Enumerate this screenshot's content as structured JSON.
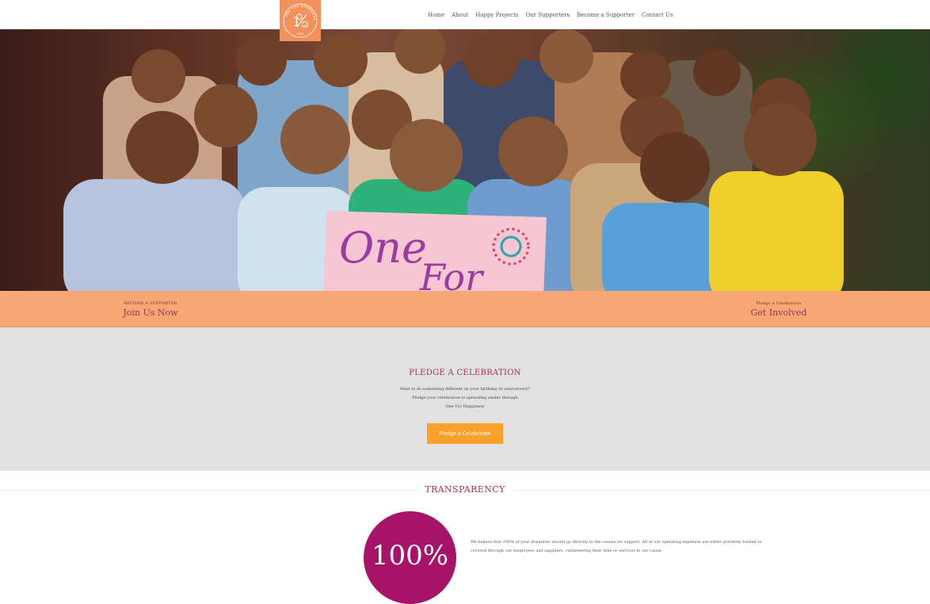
{
  "header": {
    "logo_ring_text": "ONE FOR HAPPINESS",
    "logo_bottom_text": "OFH",
    "nav": [
      "Home",
      "About",
      "Happy Projects",
      "Our Supporters",
      "Become a Supporter",
      "Contact Us"
    ]
  },
  "hero": {
    "banner_text": [
      "One",
      "For"
    ]
  },
  "band": {
    "left": {
      "small": "BECOME A SUPPORTER",
      "big": "Join Us Now"
    },
    "right": {
      "small": "Pledge a Celebration",
      "big": "Get Involved"
    }
  },
  "pledge": {
    "title": "PLEDGE A CELEBRATION",
    "lines": [
      "Want to do something different on your birthday or anniversary?",
      "Pledge your celebration to spreading smiles through",
      "One For Happiness"
    ],
    "button": "Pledge a Celebration"
  },
  "transparency": {
    "title": "TRANSPARENCY",
    "percent": "100%",
    "lines": [
      "We believe that 100% of your donations should go directly to the causes we support. All of our operating expenses are either privately funded or",
      "covered through our employees and suppliers, volunteering their time or services to our cause."
    ]
  },
  "colors": {
    "brand_orange": "#f3915a",
    "band_orange": "#f6a774",
    "accent_magenta": "#a0305a",
    "circle_magenta": "#a8136a",
    "button_orange": "#f7a12a"
  }
}
